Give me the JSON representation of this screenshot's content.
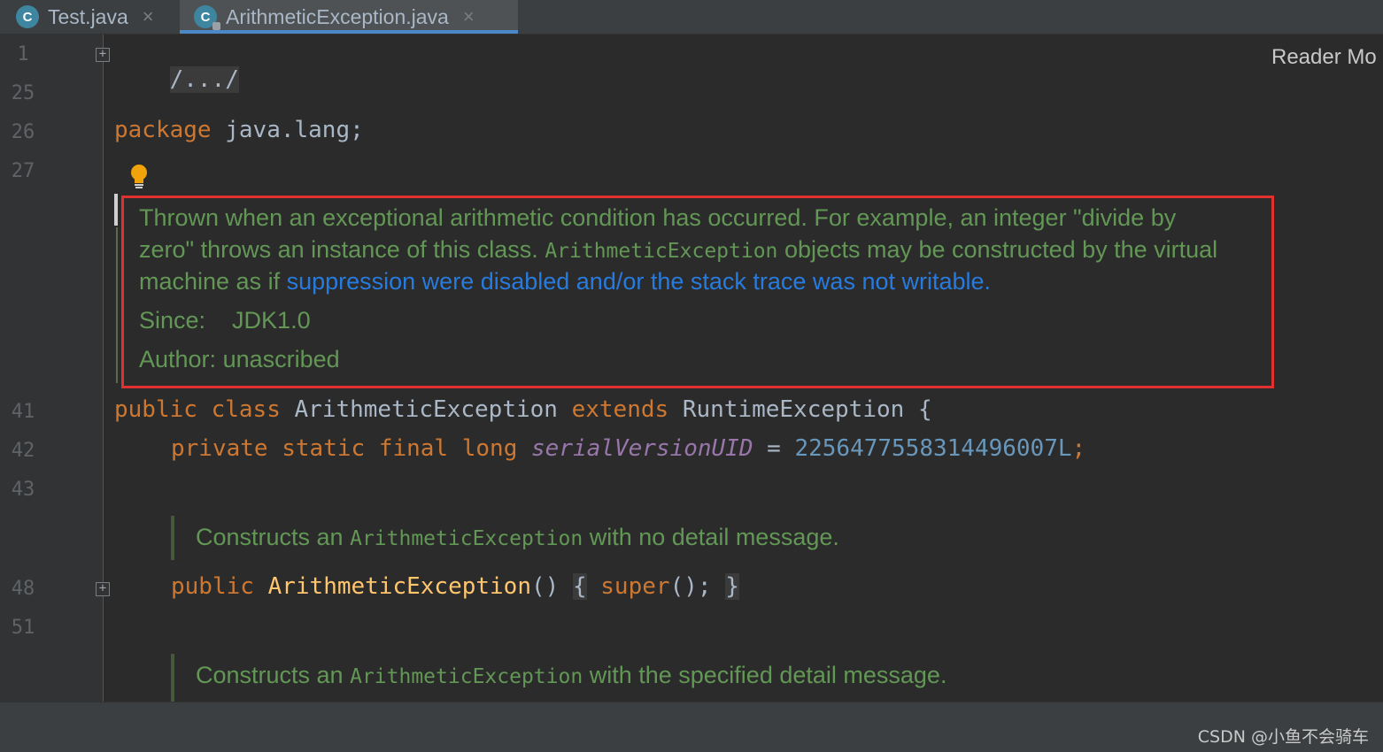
{
  "tabs": [
    {
      "label": "Test.java",
      "icon": "java-class-icon",
      "close": "×"
    },
    {
      "label": "ArithmeticException.java",
      "icon": "java-class-locked-icon",
      "close": "×",
      "active": true
    }
  ],
  "reader_mode": "Reader Mo",
  "line_numbers": [
    "1",
    "25",
    "26",
    "27",
    "41",
    "42",
    "43",
    "48",
    "51"
  ],
  "code": {
    "l1_collapsed": "/.../",
    "l26_kw": "package",
    "l26_rest": " java.lang;",
    "l41_kw1": "public",
    "l41_kw2": "class",
    "l41_name": "ArithmeticException",
    "l41_kw3": "extends",
    "l41_super": "RuntimeException",
    "l41_brace": "{",
    "l42_kw1": "private",
    "l42_kw2": "static",
    "l42_kw3": "final",
    "l42_kw4": "long",
    "l42_field": "serialVersionUID",
    "l42_eq": "=",
    "l42_num": "2256477558314496007L",
    "l42_semi": ";",
    "l48_kw": "public",
    "l48_name": "ArithmeticException",
    "l48_parens": "()",
    "l48_open": "{",
    "l48_super": "super",
    "l48_call": "();",
    "l48_close": "}"
  },
  "doc_main": {
    "line1": "Thrown when an exceptional arithmetic condition has occurred. For example, an integer \"divide by",
    "line2_a": "zero\" throws an instance of this class.",
    "line2_mono": "ArithmeticException",
    "line2_b": "objects may be constructed by the virtual",
    "line3_a": "machine as if",
    "line3_link": "suppression were disabled and/or the stack trace was not writable",
    "line3_end": ".",
    "since_label": "Since:",
    "since_value": "JDK1.0",
    "author_label": "Author:",
    "author_value": "unascribed"
  },
  "doc_ctor1": {
    "a": "Constructs an",
    "mono": "ArithmeticException",
    "b": "with no detail message."
  },
  "doc_ctor2": {
    "a": "Constructs an",
    "mono": "ArithmeticException",
    "b": "with the specified detail message."
  },
  "watermark": "CSDN @小鱼不会骑车",
  "colors": {
    "keyword": "#cc7832",
    "doc_text": "#629755",
    "doc_link": "#287bde",
    "number": "#6897bb",
    "field": "#9876aa",
    "method": "#ffc66d",
    "highlight_box": "#e0302f"
  }
}
